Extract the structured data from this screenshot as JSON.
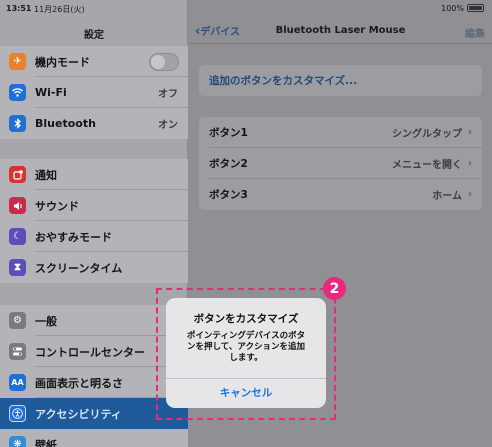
{
  "status_bar": {
    "time": "13:51",
    "date": "11月26日(火)",
    "battery_text": "100%"
  },
  "sidebar": {
    "title": "設定",
    "group1": [
      {
        "label": "機内モード",
        "icon": "airplane-icon",
        "color": "#e8822c",
        "control": "toggle"
      },
      {
        "label": "Wi-Fi",
        "icon": "wifi-icon",
        "color": "#1f70d6",
        "value": "オフ"
      },
      {
        "label": "Bluetooth",
        "icon": "bluetooth-icon",
        "color": "#1f70d6",
        "value": "オン"
      }
    ],
    "group2": [
      {
        "label": "通知",
        "icon": "notification-icon",
        "color": "#d83333"
      },
      {
        "label": "サウンド",
        "icon": "sound-icon",
        "color": "#c92b4b"
      },
      {
        "label": "おやすみモード",
        "icon": "moon-icon",
        "color": "#5a4fb9"
      },
      {
        "label": "スクリーンタイム",
        "icon": "hourglass-icon",
        "color": "#5a4fb9"
      }
    ],
    "group3": [
      {
        "label": "一般",
        "icon": "gear-icon",
        "color": "#7a7a7e"
      },
      {
        "label": "コントロールセンター",
        "icon": "switches-icon",
        "color": "#7a7a7e"
      },
      {
        "label": "画面表示と明るさ",
        "icon": "text-size-icon",
        "color": "#1f70d6"
      },
      {
        "label": "アクセシビリティ",
        "icon": "accessibility-icon",
        "color": "#1f70d6",
        "selected": true
      },
      {
        "label": "壁紙",
        "icon": "wallpaper-icon",
        "color": "#2e8fd8"
      }
    ]
  },
  "detail": {
    "back_label": "デバイス",
    "title": "Bluetooth Laser Mouse",
    "edit_label": "編集",
    "customize_link": "追加のボタンをカスタマイズ...",
    "buttons": [
      {
        "label": "ボタン1",
        "value": "シングルタップ"
      },
      {
        "label": "ボタン2",
        "value": "メニューを開く"
      },
      {
        "label": "ボタン3",
        "value": "ホーム"
      }
    ]
  },
  "dialog": {
    "title": "ボタンをカスタマイズ",
    "message_line1": "ポインティングデバイスのボタ",
    "message_line2": "ンを押して、アクションを追加",
    "message_line3": "します。",
    "cancel_label": "キャンセル"
  },
  "annotation": {
    "marker": "2",
    "color": "#e8297d"
  }
}
